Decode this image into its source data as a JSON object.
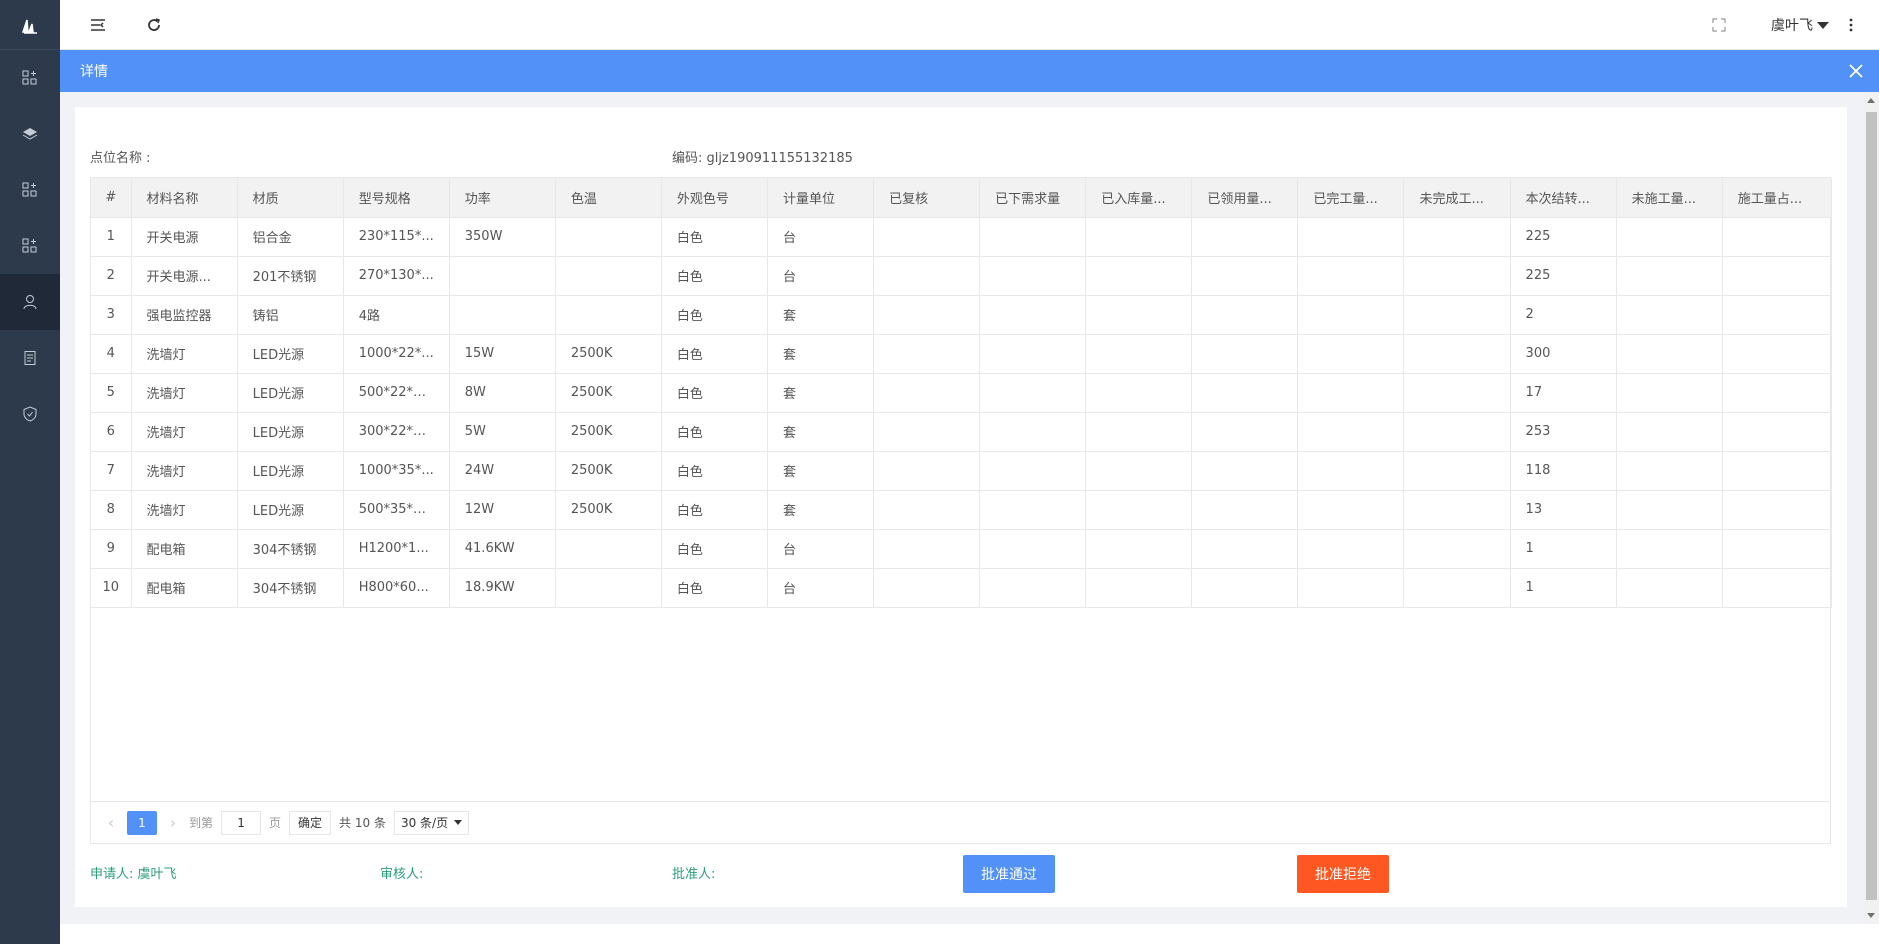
{
  "header": {
    "user_name": "虞叶飞"
  },
  "modal": {
    "title": "详情",
    "point_name_label": "点位名称 :",
    "code_label": "编码: gljz190911155132185"
  },
  "table": {
    "columns": [
      "#",
      "材料名称",
      "材质",
      "型号规格",
      "功率",
      "色温",
      "外观色号",
      "计量单位",
      "已复核",
      "已下需求量",
      "已入库量...",
      "已领用量...",
      "已完工量...",
      "未完成工...",
      "本次结转...",
      "未施工量...",
      "施工量占..."
    ],
    "rows": [
      [
        "1",
        "开关电源",
        "铝合金",
        "230*115*...",
        "350W",
        "",
        "白色",
        "台",
        "",
        "",
        "",
        "",
        "",
        "",
        "225",
        "",
        ""
      ],
      [
        "2",
        "开关电源...",
        "201不锈钢",
        "270*130*...",
        "",
        "",
        "白色",
        "台",
        "",
        "",
        "",
        "",
        "",
        "",
        "225",
        "",
        ""
      ],
      [
        "3",
        "强电监控器",
        "铸铝",
        "4路",
        "",
        "",
        "白色",
        "套",
        "",
        "",
        "",
        "",
        "",
        "",
        "2",
        "",
        ""
      ],
      [
        "4",
        "洗墙灯",
        "LED光源",
        "1000*22*...",
        "15W",
        "2500K",
        "白色",
        "套",
        "",
        "",
        "",
        "",
        "",
        "",
        "300",
        "",
        ""
      ],
      [
        "5",
        "洗墙灯",
        "LED光源",
        "500*22*H...",
        "8W",
        "2500K",
        "白色",
        "套",
        "",
        "",
        "",
        "",
        "",
        "",
        "17",
        "",
        ""
      ],
      [
        "6",
        "洗墙灯",
        "LED光源",
        "300*22*H...",
        "5W",
        "2500K",
        "白色",
        "套",
        "",
        "",
        "",
        "",
        "",
        "",
        "253",
        "",
        ""
      ],
      [
        "7",
        "洗墙灯",
        "LED光源",
        "1000*35*...",
        "24W",
        "2500K",
        "白色",
        "套",
        "",
        "",
        "",
        "",
        "",
        "",
        "118",
        "",
        ""
      ],
      [
        "8",
        "洗墙灯",
        "LED光源",
        "500*35*H...",
        "12W",
        "2500K",
        "白色",
        "套",
        "",
        "",
        "",
        "",
        "",
        "",
        "13",
        "",
        ""
      ],
      [
        "9",
        "配电箱",
        "304不锈钢",
        "H1200*1...",
        "41.6KW",
        "",
        "白色",
        "台",
        "",
        "",
        "",
        "",
        "",
        "",
        "1",
        "",
        ""
      ],
      [
        "10",
        "配电箱",
        "304不锈钢",
        "H800*60...",
        "18.9KW",
        "",
        "白色",
        "台",
        "",
        "",
        "",
        "",
        "",
        "",
        "1",
        "",
        ""
      ]
    ]
  },
  "pager": {
    "current_page": "1",
    "goto_label": "到第",
    "page_input": "1",
    "page_suffix": "页",
    "confirm": "确定",
    "total": "共 10 条",
    "page_size": "30 条/页"
  },
  "footer": {
    "applicant": "申请人: 虞叶飞",
    "reviewer": "审核人:",
    "approver": "批准人:",
    "approve_button": "批准通过",
    "reject_button": "批准拒绝"
  },
  "colors": {
    "primary": "#5291f7",
    "danger": "#ff5722",
    "sidebar": "#2d3a4b",
    "label_green": "#2a9d7c"
  }
}
